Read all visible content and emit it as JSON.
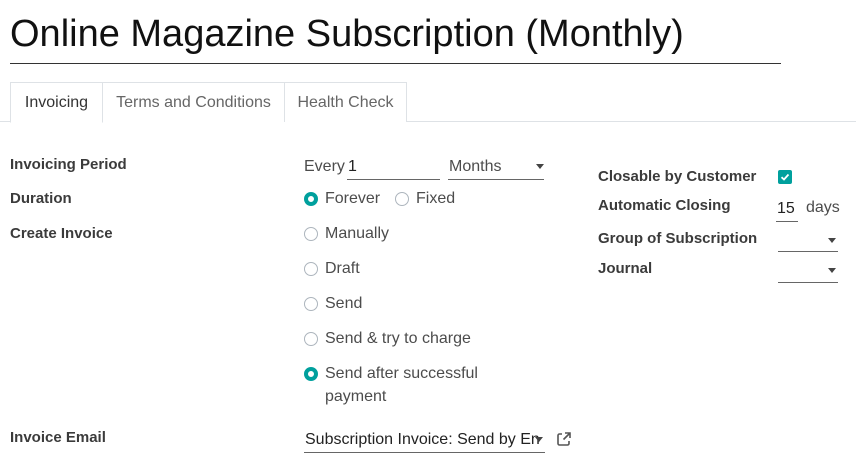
{
  "record": {
    "title": "Online Magazine Subscription (Monthly)"
  },
  "tabs": [
    {
      "label": "Invoicing",
      "active": true
    },
    {
      "label": "Terms and Conditions",
      "active": false
    },
    {
      "label": "Health Check",
      "active": false
    }
  ],
  "invoicing_period": {
    "label": "Invoicing Period",
    "prefix": "Every",
    "value": "1",
    "unit": "Months"
  },
  "duration": {
    "label": "Duration",
    "options": [
      {
        "label": "Forever",
        "selected": true
      },
      {
        "label": "Fixed",
        "selected": false
      }
    ]
  },
  "create_invoice": {
    "label": "Create Invoice",
    "options": [
      {
        "label": "Manually",
        "selected": false
      },
      {
        "label": "Draft",
        "selected": false
      },
      {
        "label": "Send",
        "selected": false
      },
      {
        "label": "Send & try to charge",
        "selected": false
      },
      {
        "label": "Send after successful",
        "label_line2": "payment",
        "selected": true
      }
    ]
  },
  "invoice_email": {
    "label": "Invoice Email",
    "value": "Subscription Invoice: Send by En"
  },
  "closable": {
    "label": "Closable by Customer",
    "checked": true
  },
  "automatic_closing": {
    "label": "Automatic Closing",
    "value": "15",
    "unit": "days"
  },
  "group_of_subscription": {
    "label": "Group of Subscription",
    "value": ""
  },
  "journal": {
    "label": "Journal",
    "value": ""
  },
  "colors": {
    "accent": "#00a09d"
  },
  "icons": {
    "external": "external-link-icon",
    "check": "check-icon",
    "dropdown": "caret-down-icon"
  }
}
